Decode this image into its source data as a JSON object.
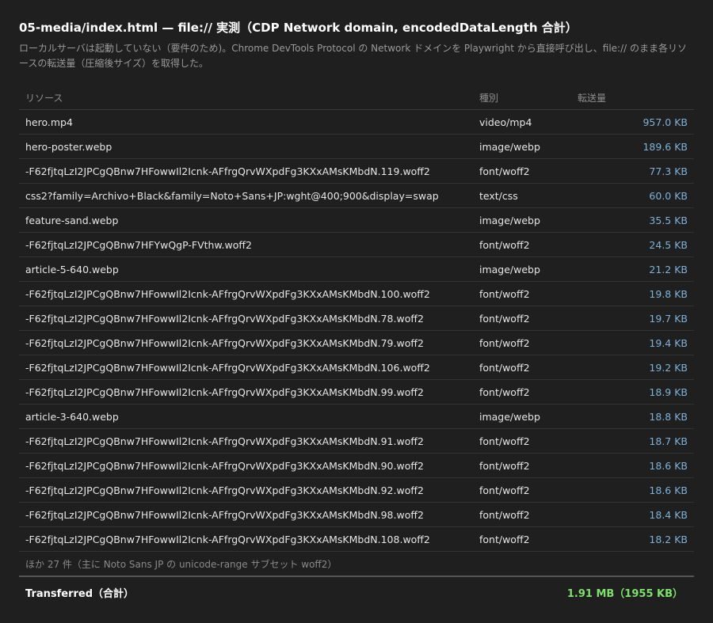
{
  "page": {
    "title": "05-media/index.html — file:// 実測（CDP Network domain, encodedDataLength 合計）",
    "description": "ローカルサーバは起動していない（要件のため)。Chrome DevTools Protocol の Network ドメインを Playwright から直接呼び出し、file:// のまま各リソースの転送量（圧縮後サイズ）を取得した。"
  },
  "table": {
    "headers": {
      "resource": "リソース",
      "type": "種別",
      "size": "転送量"
    },
    "rows": [
      {
        "name": "hero.mp4",
        "type": "video/mp4",
        "size": "957.0 KB"
      },
      {
        "name": "hero-poster.webp",
        "type": "image/webp",
        "size": "189.6 KB"
      },
      {
        "name": "-F62fjtqLzI2JPCgQBnw7HFowwIl2Icnk-AFfrgQrvWXpdFg3KXxAMsKMbdN.119.woff2",
        "type": "font/woff2",
        "size": "77.3 KB"
      },
      {
        "name": "css2?family=Archivo+Black&family=Noto+Sans+JP:wght@400;900&display=swap",
        "type": "text/css",
        "size": "60.0 KB"
      },
      {
        "name": "feature-sand.webp",
        "type": "image/webp",
        "size": "35.5 KB"
      },
      {
        "name": "-F62fjtqLzI2JPCgQBnw7HFYwQgP-FVthw.woff2",
        "type": "font/woff2",
        "size": "24.5 KB"
      },
      {
        "name": "article-5-640.webp",
        "type": "image/webp",
        "size": "21.2 KB"
      },
      {
        "name": "-F62fjtqLzI2JPCgQBnw7HFowwIl2Icnk-AFfrgQrvWXpdFg3KXxAMsKMbdN.100.woff2",
        "type": "font/woff2",
        "size": "19.8 KB"
      },
      {
        "name": "-F62fjtqLzI2JPCgQBnw7HFowwIl2Icnk-AFfrgQrvWXpdFg3KXxAMsKMbdN.78.woff2",
        "type": "font/woff2",
        "size": "19.7 KB"
      },
      {
        "name": "-F62fjtqLzI2JPCgQBnw7HFowwIl2Icnk-AFfrgQrvWXpdFg3KXxAMsKMbdN.79.woff2",
        "type": "font/woff2",
        "size": "19.4 KB"
      },
      {
        "name": "-F62fjtqLzI2JPCgQBnw7HFowwIl2Icnk-AFfrgQrvWXpdFg3KXxAMsKMbdN.106.woff2",
        "type": "font/woff2",
        "size": "19.2 KB"
      },
      {
        "name": "-F62fjtqLzI2JPCgQBnw7HFowwIl2Icnk-AFfrgQrvWXpdFg3KXxAMsKMbdN.99.woff2",
        "type": "font/woff2",
        "size": "18.9 KB"
      },
      {
        "name": "article-3-640.webp",
        "type": "image/webp",
        "size": "18.8 KB"
      },
      {
        "name": "-F62fjtqLzI2JPCgQBnw7HFowwIl2Icnk-AFfrgQrvWXpdFg3KXxAMsKMbdN.91.woff2",
        "type": "font/woff2",
        "size": "18.7 KB"
      },
      {
        "name": "-F62fjtqLzI2JPCgQBnw7HFowwIl2Icnk-AFfrgQrvWXpdFg3KXxAMsKMbdN.90.woff2",
        "type": "font/woff2",
        "size": "18.6 KB"
      },
      {
        "name": "-F62fjtqLzI2JPCgQBnw7HFowwIl2Icnk-AFfrgQrvWXpdFg3KXxAMsKMbdN.92.woff2",
        "type": "font/woff2",
        "size": "18.6 KB"
      },
      {
        "name": "-F62fjtqLzI2JPCgQBnw7HFowwIl2Icnk-AFfrgQrvWXpdFg3KXxAMsKMbdN.98.woff2",
        "type": "font/woff2",
        "size": "18.4 KB"
      },
      {
        "name": "-F62fjtqLzI2JPCgQBnw7HFowwIl2Icnk-AFfrgQrvWXpdFg3KXxAMsKMbdN.108.woff2",
        "type": "font/woff2",
        "size": "18.2 KB"
      }
    ],
    "more_note": "ほか 27 件（主に Noto Sans JP の unicode-range サブセット woff2）",
    "total": {
      "label": "Transferred（合計）",
      "value": "1.91 MB（1955 KB）"
    }
  },
  "colors": {
    "background": "#1f1f1f",
    "size_text": "#7fb1d8",
    "total_value": "#7ee06d",
    "muted_text": "#9a9a9a"
  }
}
